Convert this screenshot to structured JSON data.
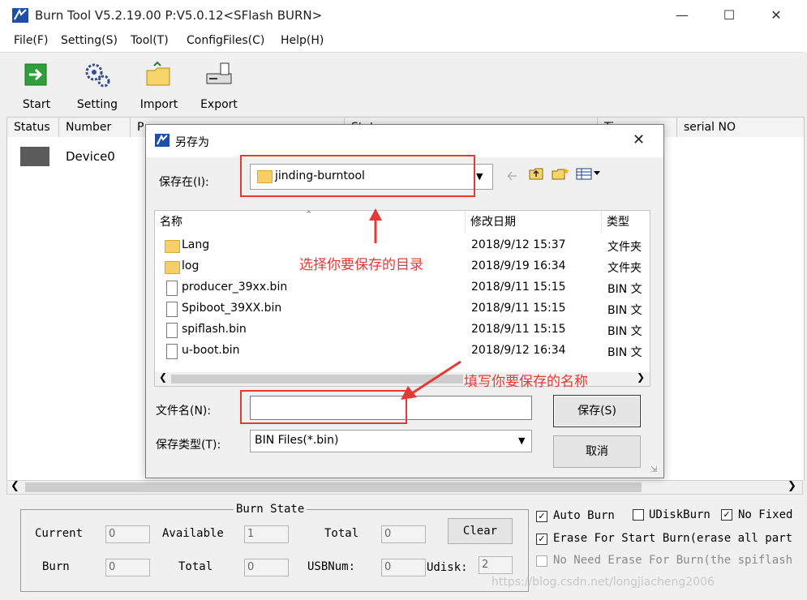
{
  "window": {
    "title": "Burn Tool V5.2.19.00 P:V5.0.12<SFlash BURN>"
  },
  "menu": [
    "File(F)",
    "Setting(S)",
    "Tool(T)",
    "ConfigFiles(C)",
    "Help(H)"
  ],
  "toolbar": {
    "start": "Start",
    "setting": "Setting",
    "import": "Import",
    "export": "Export"
  },
  "grid": {
    "columns": [
      "Status",
      "Number",
      "P",
      "Stat",
      "Ti",
      "serial NO"
    ],
    "rows": [
      {
        "number": "Device0"
      }
    ]
  },
  "burn_state": {
    "title": "Burn State",
    "current_label": "Current",
    "current_value": "0",
    "available_label": "Available",
    "available_value": "1",
    "total_label": "Total",
    "total_value": "0",
    "clear_label": "Clear",
    "burn_label": "Burn",
    "burn_value": "0",
    "total2_label": "Total",
    "total2_value": "0",
    "usbnum_label": "USBNum:",
    "usbnum_value": "0",
    "udisk_label": "Udisk:",
    "udisk_value": "2"
  },
  "options": {
    "auto_burn": "Auto Burn",
    "udisk_burn": "UDiskBurn",
    "no_fixed": "No Fixed",
    "erase": "Erase For Start Burn(erase all part",
    "no_need_erase": "No Need Erase For Burn(the spiflash"
  },
  "watermark": "https://blog.csdn.net/longjiacheng2006",
  "dialog": {
    "title": "另存为",
    "save_in_label": "保存在(I):",
    "save_in_value": "jinding-burntool",
    "columns": {
      "name": "名称",
      "modified": "修改日期",
      "type": "类型"
    },
    "files": [
      {
        "name": "Lang",
        "date": "2018/9/12 15:37",
        "type": "文件夹",
        "kind": "folder"
      },
      {
        "name": "log",
        "date": "2018/9/19 16:34",
        "type": "文件夹",
        "kind": "folder"
      },
      {
        "name": "producer_39xx.bin",
        "date": "2018/9/11 15:15",
        "type": "BIN 文",
        "kind": "file"
      },
      {
        "name": "Spiboot_39XX.bin",
        "date": "2018/9/11 15:15",
        "type": "BIN 文",
        "kind": "file"
      },
      {
        "name": "spiflash.bin",
        "date": "2018/9/11 15:15",
        "type": "BIN 文",
        "kind": "file"
      },
      {
        "name": "u-boot.bin",
        "date": "2018/9/12 16:34",
        "type": "BIN 文",
        "kind": "file"
      }
    ],
    "filename_label": "文件名(N):",
    "filename_value": "",
    "filetype_label": "保存类型(T):",
    "filetype_value": "BIN Files(*.bin)",
    "save_button": "保存(S)",
    "cancel_button": "取消"
  },
  "annotations": {
    "choose_dir": "选择你要保存的目录",
    "fill_name": "填写你要保存的名称"
  }
}
